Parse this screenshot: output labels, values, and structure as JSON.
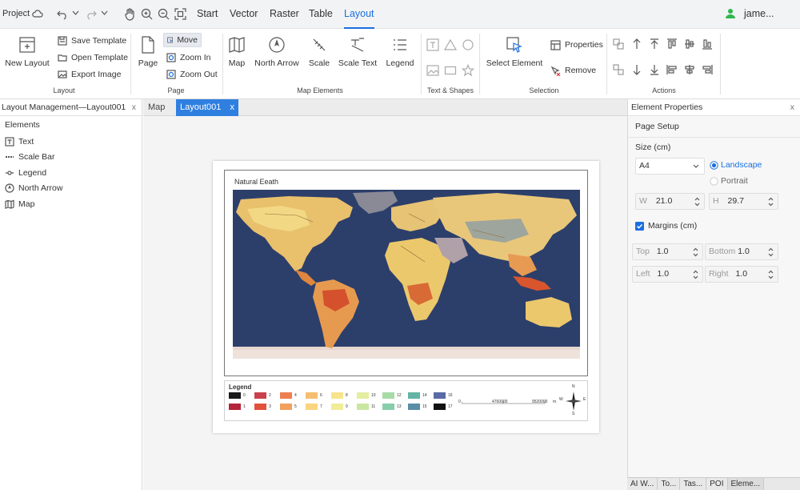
{
  "topbar": {
    "project_label": "Project",
    "menus": [
      "Start",
      "Vector",
      "Raster",
      "Table",
      "Layout"
    ],
    "active_menu": "Layout",
    "user": "jame..."
  },
  "ribbon": {
    "layout_group": {
      "label": "Layout",
      "new_layout": "New Layout",
      "save_template": "Save Template",
      "open_template": "Open Template",
      "export_image": "Export Image"
    },
    "page_group": {
      "label": "Page",
      "page": "Page",
      "move": "Move",
      "zoom_in": "Zoom In",
      "zoom_out": "Zoom Out"
    },
    "map_elements_group": {
      "label": "Map Elements",
      "map": "Map",
      "north_arrow": "North Arrow",
      "scale": "Scale",
      "scale_text": "Scale Text",
      "legend": "Legend"
    },
    "text_shapes_group": {
      "label": "Text & Shapes"
    },
    "selection_group": {
      "label": "Selection",
      "select_element": "Select Element",
      "properties": "Properties",
      "remove": "Remove"
    },
    "actions_group": {
      "label": "Actions"
    }
  },
  "left_panel": {
    "title": "Layout Management—Layout001",
    "close": "x",
    "section": "Elements",
    "elements": [
      {
        "label": "Text",
        "icon": "text-box-icon"
      },
      {
        "label": "Scale Bar",
        "icon": "scale-bar-icon"
      },
      {
        "label": "Legend",
        "icon": "legend-icon"
      },
      {
        "label": "North Arrow",
        "icon": "north-arrow-icon"
      },
      {
        "label": "Map",
        "icon": "map-icon"
      }
    ]
  },
  "tabs": [
    {
      "label": "Map",
      "active": false
    },
    {
      "label": "Layout001",
      "active": true,
      "close": "x"
    }
  ],
  "layout_page": {
    "map_title": "Natural Eeath",
    "legend_title": "Legend",
    "legend_items": [
      {
        "label": "0",
        "color": "#1a1a1a"
      },
      {
        "label": "1",
        "color": "#b5243a"
      },
      {
        "label": "2",
        "color": "#c9414a"
      },
      {
        "label": "3",
        "color": "#e0523c"
      },
      {
        "label": "4",
        "color": "#ee7d50"
      },
      {
        "label": "5",
        "color": "#f2a05e"
      },
      {
        "label": "6",
        "color": "#f6be70"
      },
      {
        "label": "7",
        "color": "#fad47f"
      },
      {
        "label": "8",
        "color": "#f7e48c"
      },
      {
        "label": "9",
        "color": "#f1ec98"
      },
      {
        "label": "10",
        "color": "#e4eea0"
      },
      {
        "label": "11",
        "color": "#c9e7a0"
      },
      {
        "label": "12",
        "color": "#a7dba6"
      },
      {
        "label": "13",
        "color": "#86ceaa"
      },
      {
        "label": "14",
        "color": "#64b4a6"
      },
      {
        "label": "15",
        "color": "#5a8ea6"
      },
      {
        "label": "16",
        "color": "#5a6aa6"
      },
      {
        "label": "17",
        "color": "#111111"
      }
    ],
    "scale_labels": [
      "0",
      "4760000",
      "9520000",
      "m"
    ],
    "compass": {
      "n": "N",
      "s": "S",
      "e": "E",
      "w": "W"
    }
  },
  "right_panel": {
    "title": "Element Properties",
    "close": "x",
    "section": "Page Setup",
    "size_label": "Size (cm)",
    "size_value": "A4",
    "landscape": "Landscape",
    "portrait": "Portrait",
    "orientation": "Landscape",
    "w_label": "W",
    "w_value": "21.0",
    "h_label": "H",
    "h_value": "29.7",
    "margins_label": "Margins (cm)",
    "margins_checked": true,
    "top_label": "Top",
    "top_value": "1.0",
    "bottom_label": "Bottom",
    "bottom_value": "1.0",
    "left_label": "Left",
    "left_value": "1.0",
    "right_label": "Right",
    "right_value": "1.0"
  },
  "bottom_tabs": [
    "AI W...",
    "To...",
    "Tas...",
    "POI",
    "Eleme..."
  ],
  "colors": {
    "accent": "#1a6fe0",
    "ocean": "#2c3f6b",
    "land": "#f0d27a"
  }
}
